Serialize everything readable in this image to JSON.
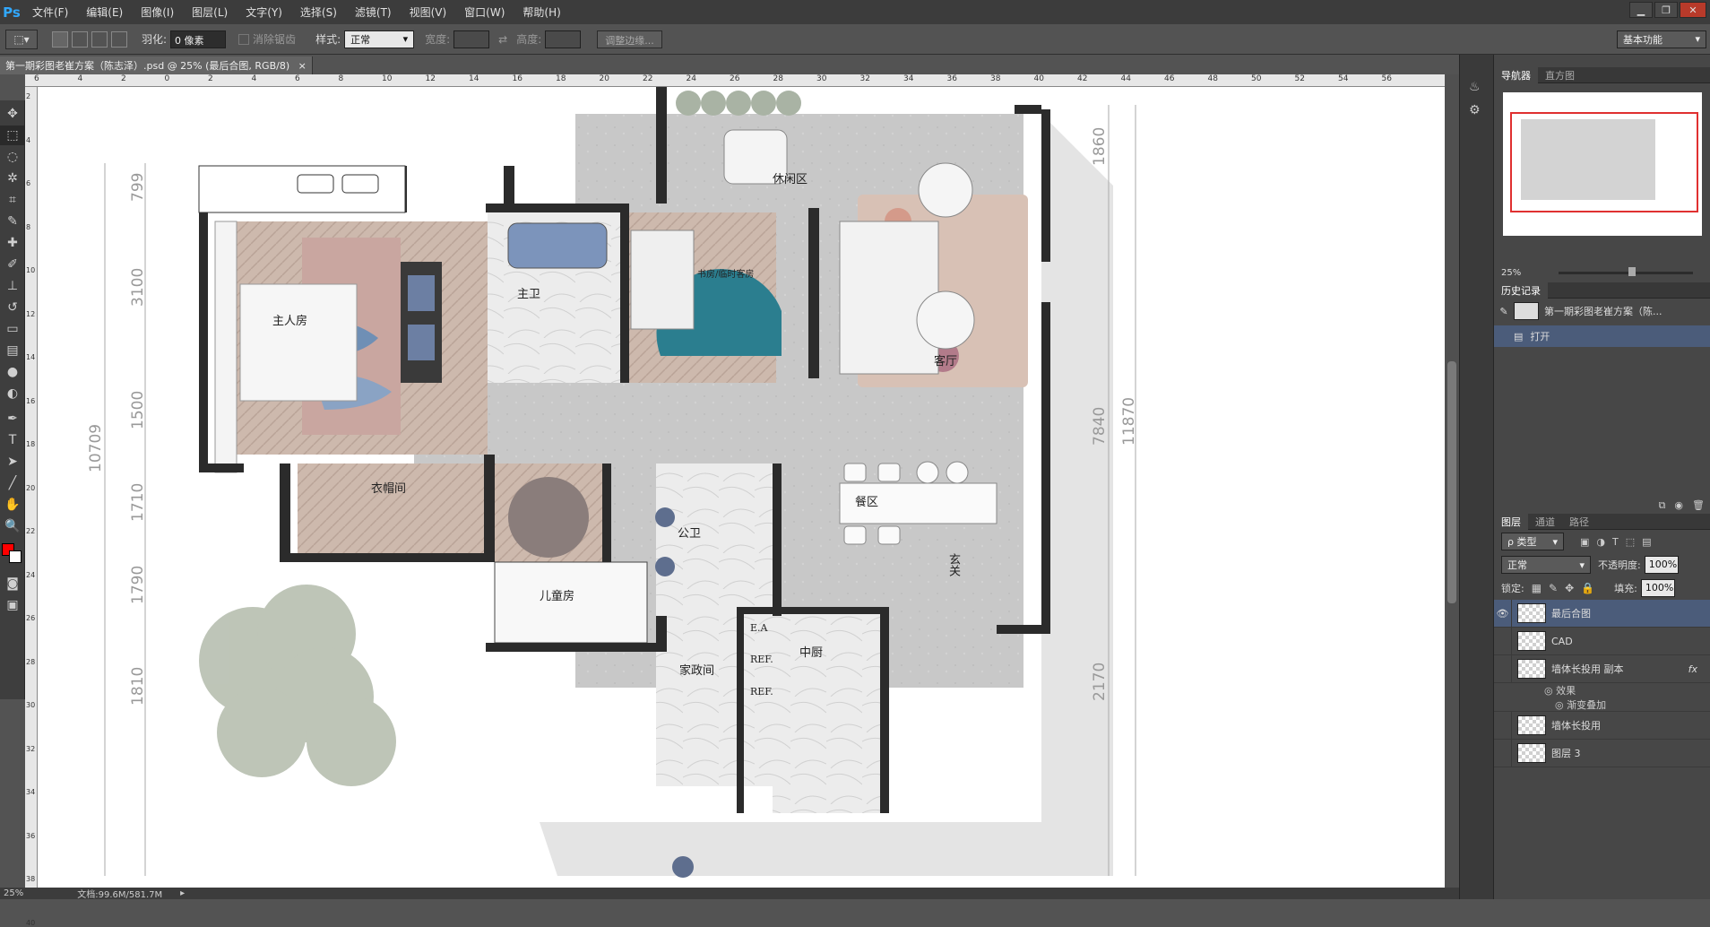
{
  "app": {
    "logo": "Ps",
    "menu": [
      "文件(F)",
      "编辑(E)",
      "图像(I)",
      "图层(L)",
      "文字(Y)",
      "选择(S)",
      "滤镜(T)",
      "视图(V)",
      "窗口(W)",
      "帮助(H)"
    ]
  },
  "options": {
    "feather_label": "羽化:",
    "feather_value": "0 像素",
    "antialias_label": "消除锯齿",
    "style_label": "样式:",
    "style_value": "正常",
    "width_label": "宽度:",
    "height_label": "高度:",
    "refine_edge": "调整边缘...",
    "workspace": "基本功能"
  },
  "document": {
    "tab_title": "第一期彩图老崔方案（陈志泽）.psd @ 25% (最后合图, RGB/8)",
    "close": "×"
  },
  "ruler": {
    "top": [
      "6",
      "4",
      "2",
      "0",
      "2",
      "4",
      "6",
      "8",
      "10",
      "12",
      "14",
      "16",
      "18",
      "20",
      "22",
      "24",
      "26",
      "28",
      "30",
      "32",
      "34",
      "36",
      "38",
      "40",
      "42",
      "44",
      "46",
      "48",
      "50",
      "52",
      "54",
      "56"
    ],
    "left": [
      "2",
      "4",
      "6",
      "8",
      "10",
      "12",
      "14",
      "16",
      "18",
      "20",
      "22",
      "24",
      "26",
      "28",
      "30",
      "32",
      "34",
      "36",
      "38",
      "40"
    ]
  },
  "status": {
    "zoom": "25%",
    "doc_size": "文档:99.6M/581.7M"
  },
  "navigator": {
    "tabs": [
      "导航器",
      "直方图"
    ],
    "zoom": "25%"
  },
  "history": {
    "tab": "历史记录",
    "items": [
      "第一期彩图老崔方案（陈...",
      "打开"
    ]
  },
  "layers_panel": {
    "tabs": [
      "图层",
      "通道",
      "路径"
    ],
    "filter": "ρ 类型",
    "blend_mode": "正常",
    "opacity_label": "不透明度:",
    "opacity_value": "100%",
    "lock_label": "锁定:",
    "fill_label": "填充:",
    "fill_value": "100%",
    "layers": [
      {
        "name": "最后合图",
        "visible": true,
        "selected": true
      },
      {
        "name": "CAD",
        "visible": false,
        "selected": false
      },
      {
        "name": "墙体长投用 副本",
        "visible": false,
        "selected": false,
        "fx": "fx"
      },
      {
        "name": "效果",
        "sub": true
      },
      {
        "name": "渐变叠加",
        "sub": true
      },
      {
        "name": "墙体长投用",
        "visible": false,
        "selected": false
      },
      {
        "name": "图层 3",
        "visible": false,
        "selected": false
      }
    ]
  },
  "floorplan": {
    "rooms": {
      "master_bedroom": "主人房",
      "master_bath": "主卫",
      "study": "书房/临时客房",
      "lounge": "休闲区",
      "living": "客厅",
      "wardrobe": "衣帽间",
      "public_bath": "公卫",
      "kids_room": "儿童房",
      "dining": "餐区",
      "entrance": "玄关",
      "utility": "家政间",
      "kitchen": "中厨",
      "ea": "E.A",
      "ref1": "REF.",
      "ref2": "REF."
    },
    "dims": {
      "left_total": "10709",
      "left_a": "799",
      "left_b": "3100",
      "left_c": "1500",
      "left_d": "1710",
      "left_e": "1790",
      "left_f": "1810",
      "right_a": "1860",
      "right_b": "7840",
      "right_c": "11870",
      "right_d": "2170"
    }
  },
  "colors": {
    "accent_red": "#ff0000",
    "selected_layer": "#4b5c7a",
    "ps_blue": "#31a8ff"
  }
}
